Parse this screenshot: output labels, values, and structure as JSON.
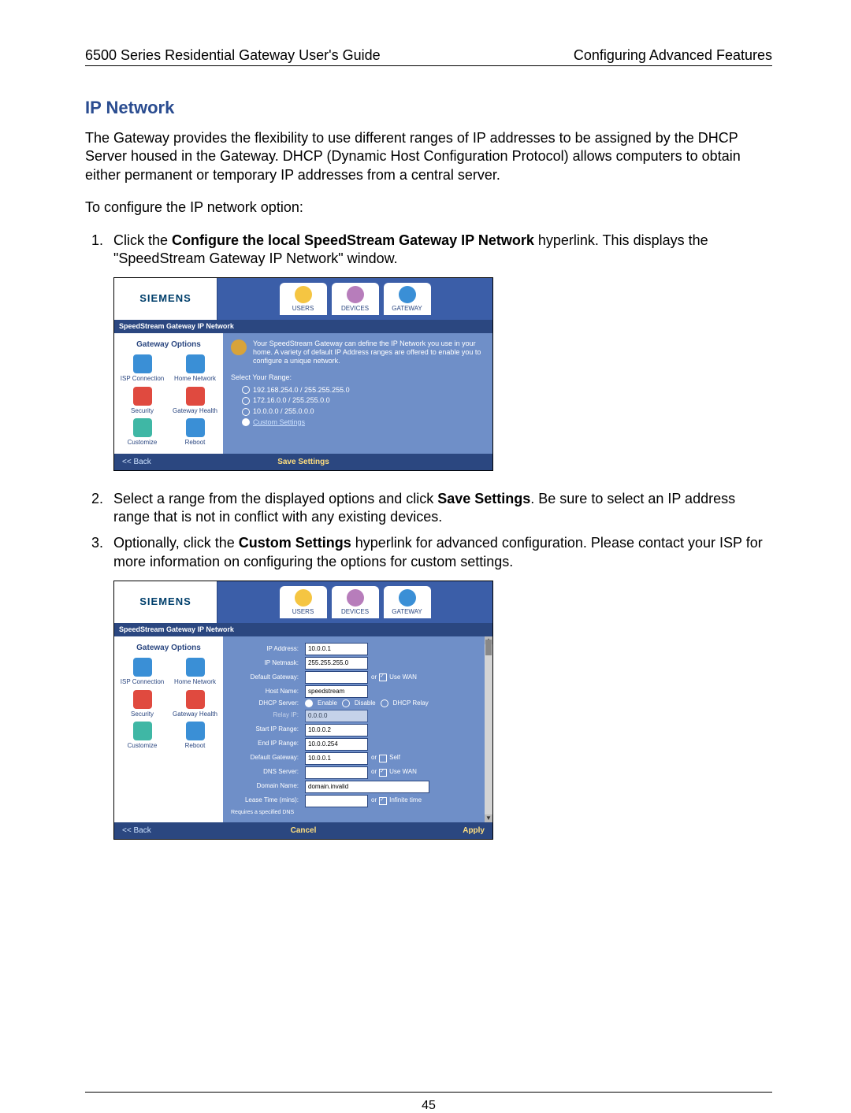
{
  "header": {
    "left": "6500 Series Residential Gateway User's Guide",
    "right": "Configuring Advanced Features"
  },
  "section_title": "IP Network",
  "para1": "The Gateway provides the flexibility to use different ranges of IP addresses to be assigned by the DHCP Server housed in the Gateway. DHCP (Dynamic Host Configuration Protocol) allows computers to obtain either permanent or temporary IP addresses from a central server.",
  "para2": "To configure the IP network option:",
  "step1_pre": "Click the ",
  "step1_bold": "Configure the local SpeedStream Gateway IP Network",
  "step1_post": " hyperlink. This displays the \"SpeedStream Gateway IP Network\" window.",
  "step2_pre": "Select a range from the displayed options and click ",
  "step2_bold": "Save Settings",
  "step2_post": ". Be sure to select an IP address range that is not in conflict with any existing devices.",
  "step3_pre": "Optionally, click the ",
  "step3_bold": "Custom Settings",
  "step3_post": " hyperlink for advanced configuration. Please contact your ISP for more information on configuring the options for custom settings.",
  "page_number": "45",
  "ss_shared": {
    "logo": "SIEMENS",
    "tabs": {
      "users": "USERS",
      "devices": "DEVICES",
      "gateway": "GATEWAY"
    },
    "bar_title": "SpeedStream Gateway IP Network",
    "side_title": "Gateway Options",
    "side_items": {
      "isp": "ISP Connection",
      "home": "Home Network",
      "security": "Security",
      "health": "Gateway Health",
      "customize": "Customize",
      "reboot": "Reboot"
    }
  },
  "ss1": {
    "intro": "Your SpeedStream Gateway can define the IP Network you use in your home. A variety of default IP Address ranges are offered to enable you to configure a unique network.",
    "select_title": "Select Your Range:",
    "opt1": "192.168.254.0 / 255.255.255.0",
    "opt2": "172.16.0.0 / 255.255.0.0",
    "opt3": "10.0.0.0 / 255.0.0.0",
    "opt4": "Custom Settings",
    "back": "<< Back",
    "save": "Save Settings"
  },
  "ss2": {
    "fields": {
      "ip_address_lbl": "IP Address:",
      "ip_address": "10.0.0.1",
      "ip_netmask_lbl": "IP Netmask:",
      "ip_netmask": "255.255.255.0",
      "default_gw_lbl": "Default Gateway:",
      "default_gw": "",
      "default_gw_or": "or",
      "default_gw_use_wan": "Use WAN",
      "host_lbl": "Host Name:",
      "host": "speedstream",
      "dhcp_lbl": "DHCP Server:",
      "dhcp_enable": "Enable",
      "dhcp_disable": "Disable",
      "dhcp_relay": "DHCP Relay",
      "relay_lbl": "Relay IP:",
      "relay": "0.0.0.0",
      "start_lbl": "Start IP Range:",
      "start": "10.0.0.2",
      "end_lbl": "End IP Range:",
      "end": "10.0.0.254",
      "def_gw2_lbl": "Default Gateway:",
      "def_gw2": "10.0.0.1",
      "def_gw2_or": "or",
      "def_gw2_self": "Self",
      "dns_lbl": "DNS Server:",
      "dns": "",
      "dns_or": "or",
      "dns_use_wan": "Use WAN",
      "domain_lbl": "Domain Name:",
      "domain": "domain.invalid",
      "lease_lbl": "Lease Time (mins):",
      "lease_or": "or",
      "lease_inf": "Infinite time",
      "dns_req": "Requires a specified DNS"
    },
    "back": "<< Back",
    "cancel": "Cancel",
    "apply": "Apply"
  }
}
